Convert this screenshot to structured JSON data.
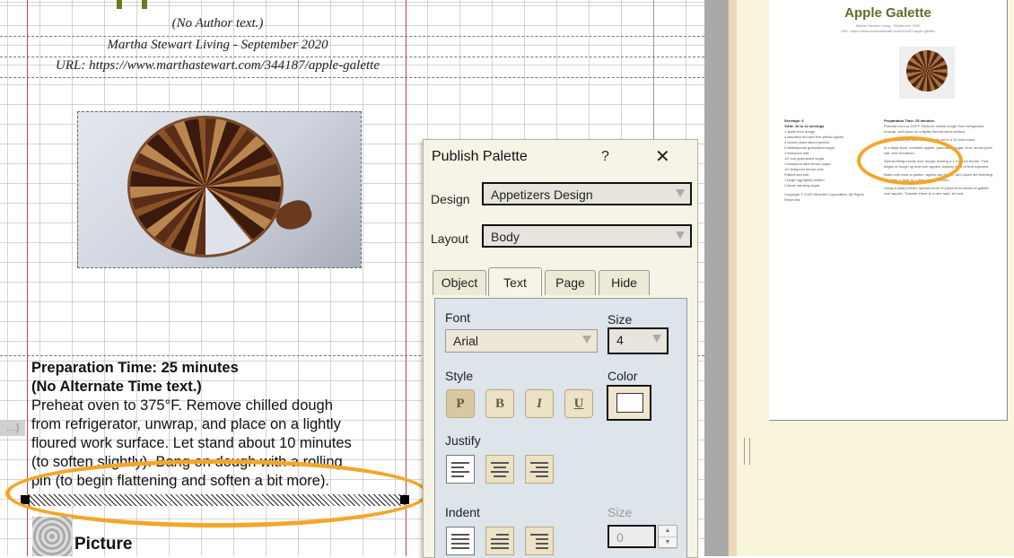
{
  "editor": {
    "author_line": "(No Author text.)",
    "source_line": "Martha Stewart Living - September 2020",
    "url_line": "URL: https://www.marthastewart.com/344187/apple-galette",
    "prep_time": "Preparation Time: 25 minutes",
    "alt_time": "(No Alternate Time text.)",
    "body_lines": [
      "Preheat oven to 375°F. Remove chilled dough",
      "from refrigerator, unwrap, and place on a lightly",
      "floured work surface. Let stand about 10 minutes",
      "(to soften slightly). Bang on dough with a rolling",
      "pin (to begin flattening and soften a bit more)."
    ],
    "picture_label": "Picture"
  },
  "preview": {
    "title": "Apple Galette",
    "tiny_source": "Martha Stewart Living - September 2020",
    "tiny_url": "URL: https://www.marthastewart.com/344187/apple-galette",
    "left_col": [
      "Servings: 6",
      "Yield: 10 to 12 servings",
      "1 apple flour dough",
      "4 assorted red and firm yellow apples",
      "3 ounce pears sliced peeled",
      "2 tablespoons granulated sugar",
      "1 teaspoon salt",
      "1/2 cup granulated sugar",
      "1 teaspoon dark brown sugar",
      "1/2 teaspoon lemon zest",
      "Flaked sea salt",
      "1 large egg lightly beaten",
      "Coarse sanding sugar",
      "Copyright © 2020 Meredith Corporation. All Rights Reserved."
    ],
    "right_col": [
      "Preparation Time: 25 minutes",
      "Preheat oven to 375°F. Remove chilled dough from refrigerator, unwrap, and place on a lightly floured work surface.",
      "Dust top and pin with flour, and roll out to a 15-inch round.",
      "In a large bowl, combine apples, granulated sugar, flour, lemon juice, salt, and cinnamon.",
      "Spread filling evenly over dough, leaving a 1 1/2-inch border. Fold edges of dough up and over apples, leaving most of fruit exposed.",
      "Bake until crust is golden, apples are tender, and juices are bubbling in center, 1 hour to 1 hour and 5 minutes.",
      "Using a pastry brush, spread some of juices from center of galette over apples. Transfer sheet to a wire rack; let cool."
    ]
  },
  "palette": {
    "title": "Publish Palette",
    "help": "?",
    "close": "X",
    "design_label": "Design",
    "design_value": "Appetizers Design",
    "layout_label": "Layout",
    "layout_value": "Body",
    "tabs": [
      "Object",
      "Text",
      "Page",
      "Hide"
    ],
    "active_tab": "Text",
    "font_label": "Font",
    "font_value": "Arial",
    "size_label": "Size",
    "size_value": "4",
    "style_label": "Style",
    "style_buttons": [
      "P",
      "B",
      "I",
      "U"
    ],
    "color_label": "Color",
    "justify_label": "Justify",
    "indent_label": "Indent",
    "indent_size_label": "Size",
    "indent_size_value": "0"
  },
  "colors": {
    "highlight": "#f3a62a",
    "preview_title": "#5e6d2a",
    "margin_line": "#b14a4a"
  }
}
